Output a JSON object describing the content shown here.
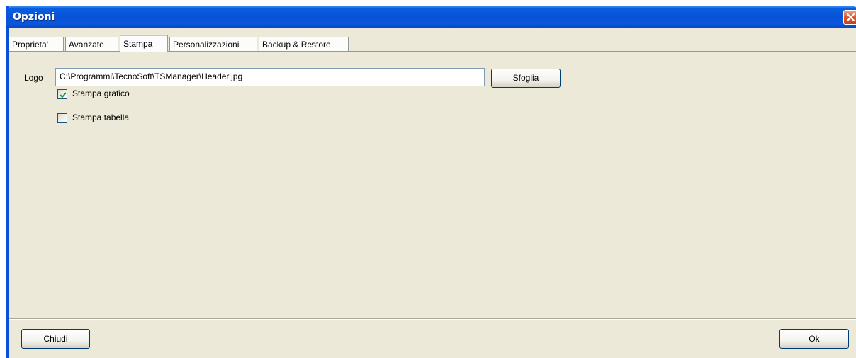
{
  "window": {
    "title": "Opzioni"
  },
  "tabs": [
    {
      "label": "Proprieta'"
    },
    {
      "label": "Avanzate"
    },
    {
      "label": "Stampa"
    },
    {
      "label": "Personalizzazioni"
    },
    {
      "label": "Backup & Restore"
    }
  ],
  "active_tab": "Stampa",
  "stampa": {
    "logo_label": "Logo",
    "logo_path": "C:\\Programmi\\TecnoSoft\\TSManager\\Header.jpg",
    "browse_label": "Sfoglia",
    "print_chart_label": "Stampa grafico",
    "print_chart_checked": true,
    "print_table_label": "Stampa tabella",
    "print_table_checked": false
  },
  "footer": {
    "close_label": "Chiudi",
    "ok_label": "Ok"
  },
  "colors": {
    "titlebar": "#0653d8",
    "dialog_bg": "#ece9d8",
    "close_button": "#e05a30",
    "active_tab_accent": "#ffc83c",
    "checkmark": "#21a121"
  },
  "icons": {
    "close": "close-icon",
    "check": "checkmark-icon"
  }
}
